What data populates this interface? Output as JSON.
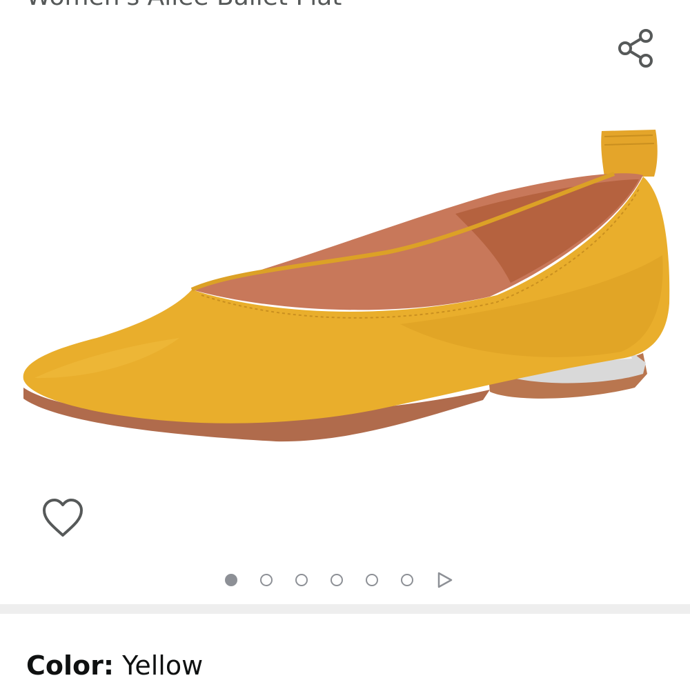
{
  "product": {
    "title": "Women's Allee Ballet Flat"
  },
  "icons": {
    "share": "share-icon",
    "wishlist": "heart-outline-icon",
    "carousel_next": "play-triangle-icon"
  },
  "carousel": {
    "total_dots": 6,
    "active_index": 0
  },
  "variation": {
    "color_label": "Color:",
    "color_value": "Yellow"
  },
  "colors": {
    "shoe_suede": "#e9ae2c",
    "lining": "#c8785a",
    "icon_gray": "#565959",
    "divider": "#eeeeee"
  }
}
